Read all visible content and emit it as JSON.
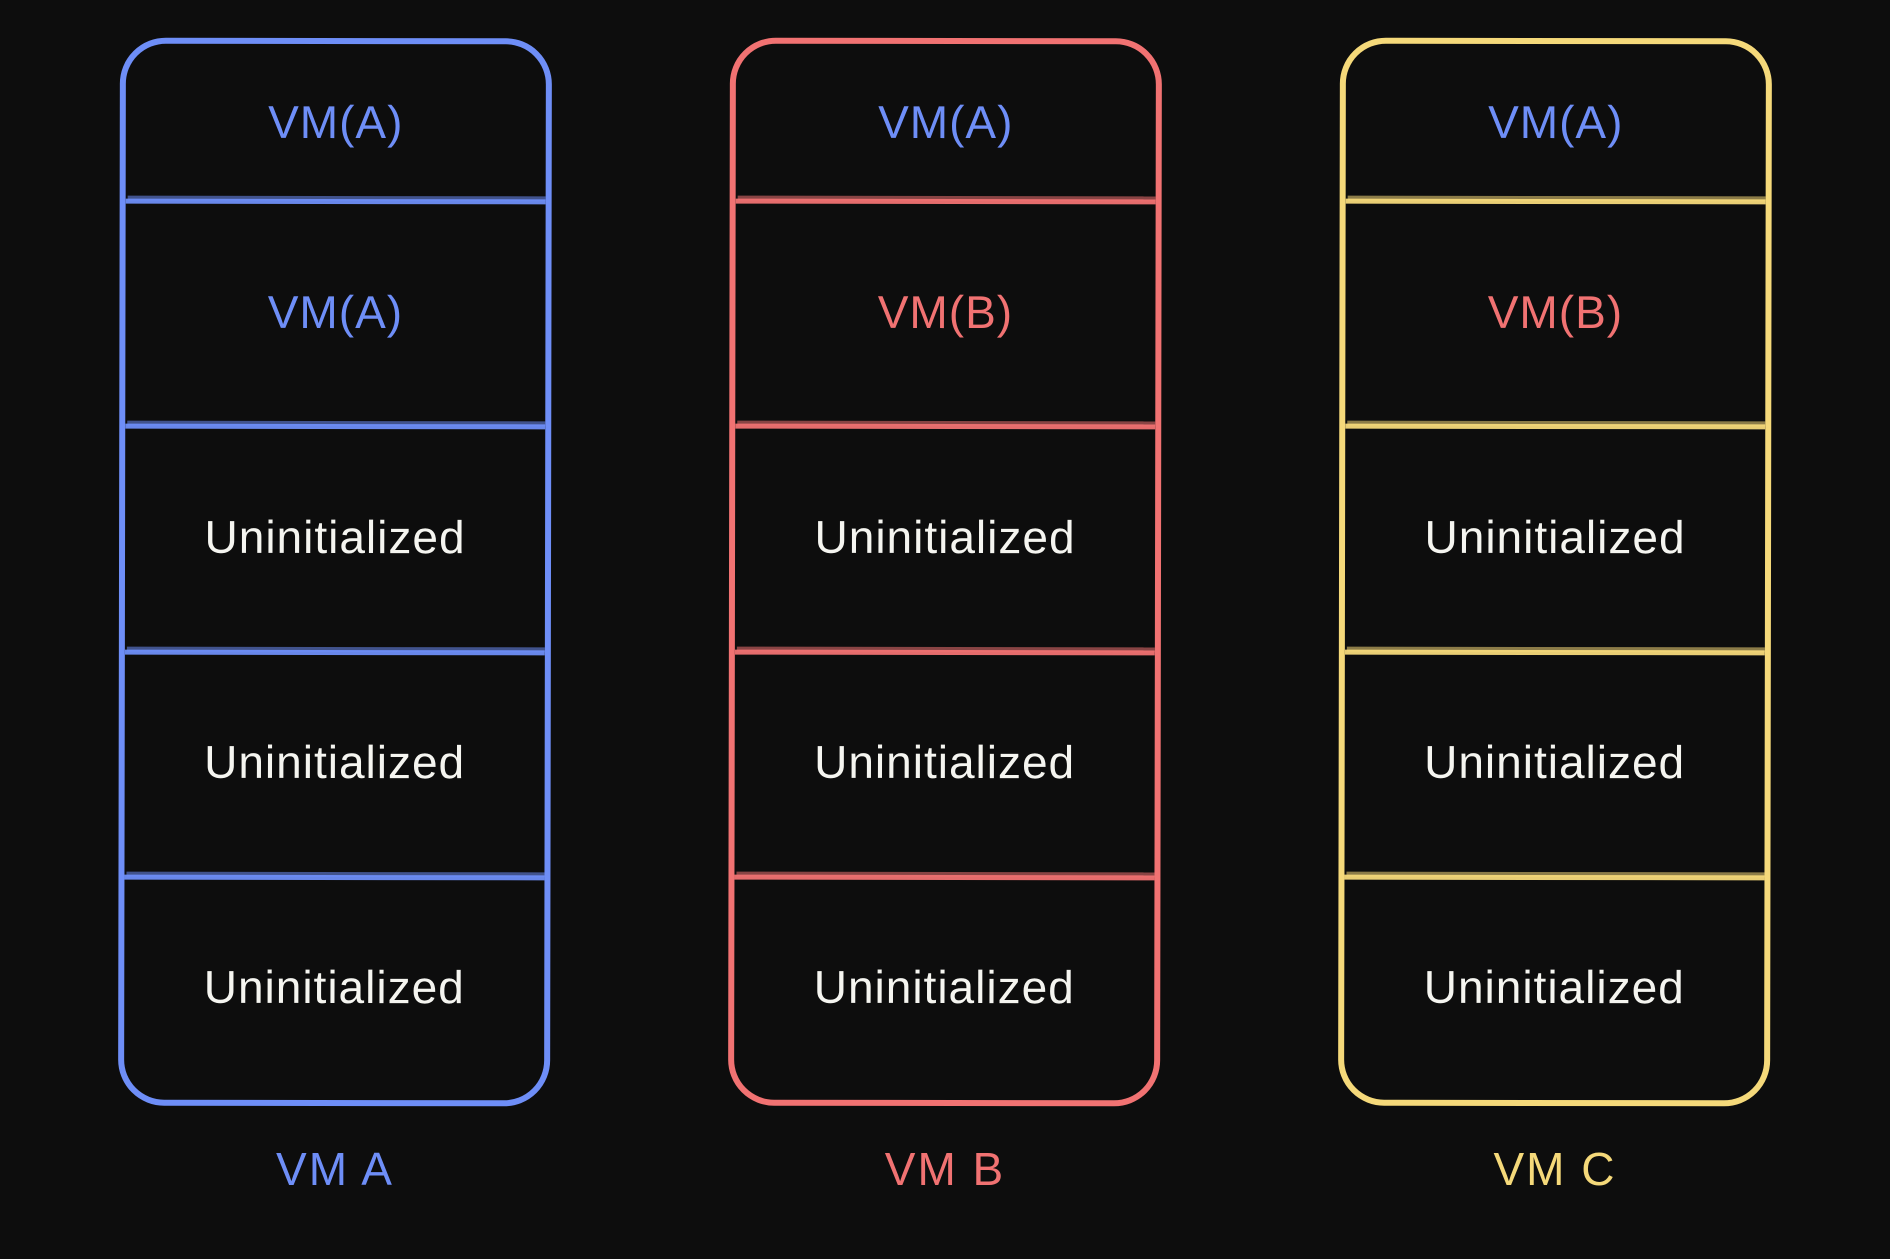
{
  "colors": {
    "blue": "#6e8ef7",
    "red": "#f17272",
    "yellow": "#f5d97a",
    "white": "#f5f5f0"
  },
  "vms": [
    {
      "key": "A",
      "title": "VM A",
      "accent": "blue",
      "slots": [
        {
          "label": "VM(A)",
          "color": "blue"
        },
        {
          "label": "VM(A)",
          "color": "blue"
        },
        {
          "label": "Uninitialized",
          "color": "white"
        },
        {
          "label": "Uninitialized",
          "color": "white"
        },
        {
          "label": "Uninitialized",
          "color": "white"
        }
      ]
    },
    {
      "key": "B",
      "title": "VM B",
      "accent": "red",
      "slots": [
        {
          "label": "VM(A)",
          "color": "blue"
        },
        {
          "label": "VM(B)",
          "color": "red"
        },
        {
          "label": "Uninitialized",
          "color": "white"
        },
        {
          "label": "Uninitialized",
          "color": "white"
        },
        {
          "label": "Uninitialized",
          "color": "white"
        }
      ]
    },
    {
      "key": "C",
      "title": "VM C",
      "accent": "yellow",
      "slots": [
        {
          "label": "VM(A)",
          "color": "blue"
        },
        {
          "label": "VM(B)",
          "color": "red"
        },
        {
          "label": "Uninitialized",
          "color": "white"
        },
        {
          "label": "Uninitialized",
          "color": "white"
        },
        {
          "label": "Uninitialized",
          "color": "white"
        }
      ]
    }
  ]
}
